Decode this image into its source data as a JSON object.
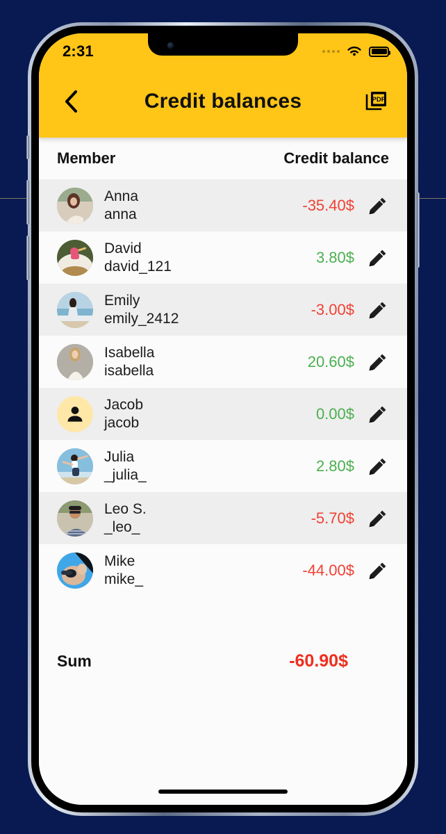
{
  "background": {
    "color": "#081a51"
  },
  "statusbar": {
    "time": "2:31",
    "signal_icon": "signal-dots-icon",
    "wifi_icon": "wifi-icon",
    "battery_icon": "battery-full-icon"
  },
  "appbar": {
    "background_color": "#ffc517",
    "back_icon": "chevron-left-icon",
    "title": "Credit balances",
    "pdf_icon": "pdf-export-icon",
    "pdf_label": "PDF"
  },
  "table": {
    "columns": [
      "Member",
      "Credit balance"
    ],
    "edit_icon": "pencil-icon",
    "rows": [
      {
        "name": "Anna",
        "handle": "anna",
        "amount": "-35.40$",
        "sign": "neg",
        "avatar": "photo-anna"
      },
      {
        "name": "David",
        "handle": "david_121",
        "amount": "3.80$",
        "sign": "pos",
        "avatar": "photo-david"
      },
      {
        "name": "Emily",
        "handle": "emily_2412",
        "amount": "-3.00$",
        "sign": "neg",
        "avatar": "photo-emily"
      },
      {
        "name": "Isabella",
        "handle": "isabella",
        "amount": "20.60$",
        "sign": "pos",
        "avatar": "photo-isabella"
      },
      {
        "name": "Jacob",
        "handle": "jacob",
        "amount": "0.00$",
        "sign": "pos",
        "avatar": "person-placeholder-icon"
      },
      {
        "name": "Julia",
        "handle": "_julia_",
        "amount": "2.80$",
        "sign": "pos",
        "avatar": "photo-julia"
      },
      {
        "name": "Leo S.",
        "handle": "_leo_",
        "amount": "-5.70$",
        "sign": "neg",
        "avatar": "photo-leo"
      },
      {
        "name": "Mike",
        "handle": "mike_",
        "amount": "-44.00$",
        "sign": "neg",
        "avatar": "photo-mike"
      }
    ]
  },
  "summary": {
    "label": "Sum",
    "value": "-60.90$"
  },
  "colors": {
    "negative": "#f04134",
    "positive": "#4caf50",
    "sum_negative": "#f02e1e",
    "accent_yellow": "#ffc517",
    "row_alt": "#eeeeee",
    "row_plain": "#fbfbfb"
  }
}
